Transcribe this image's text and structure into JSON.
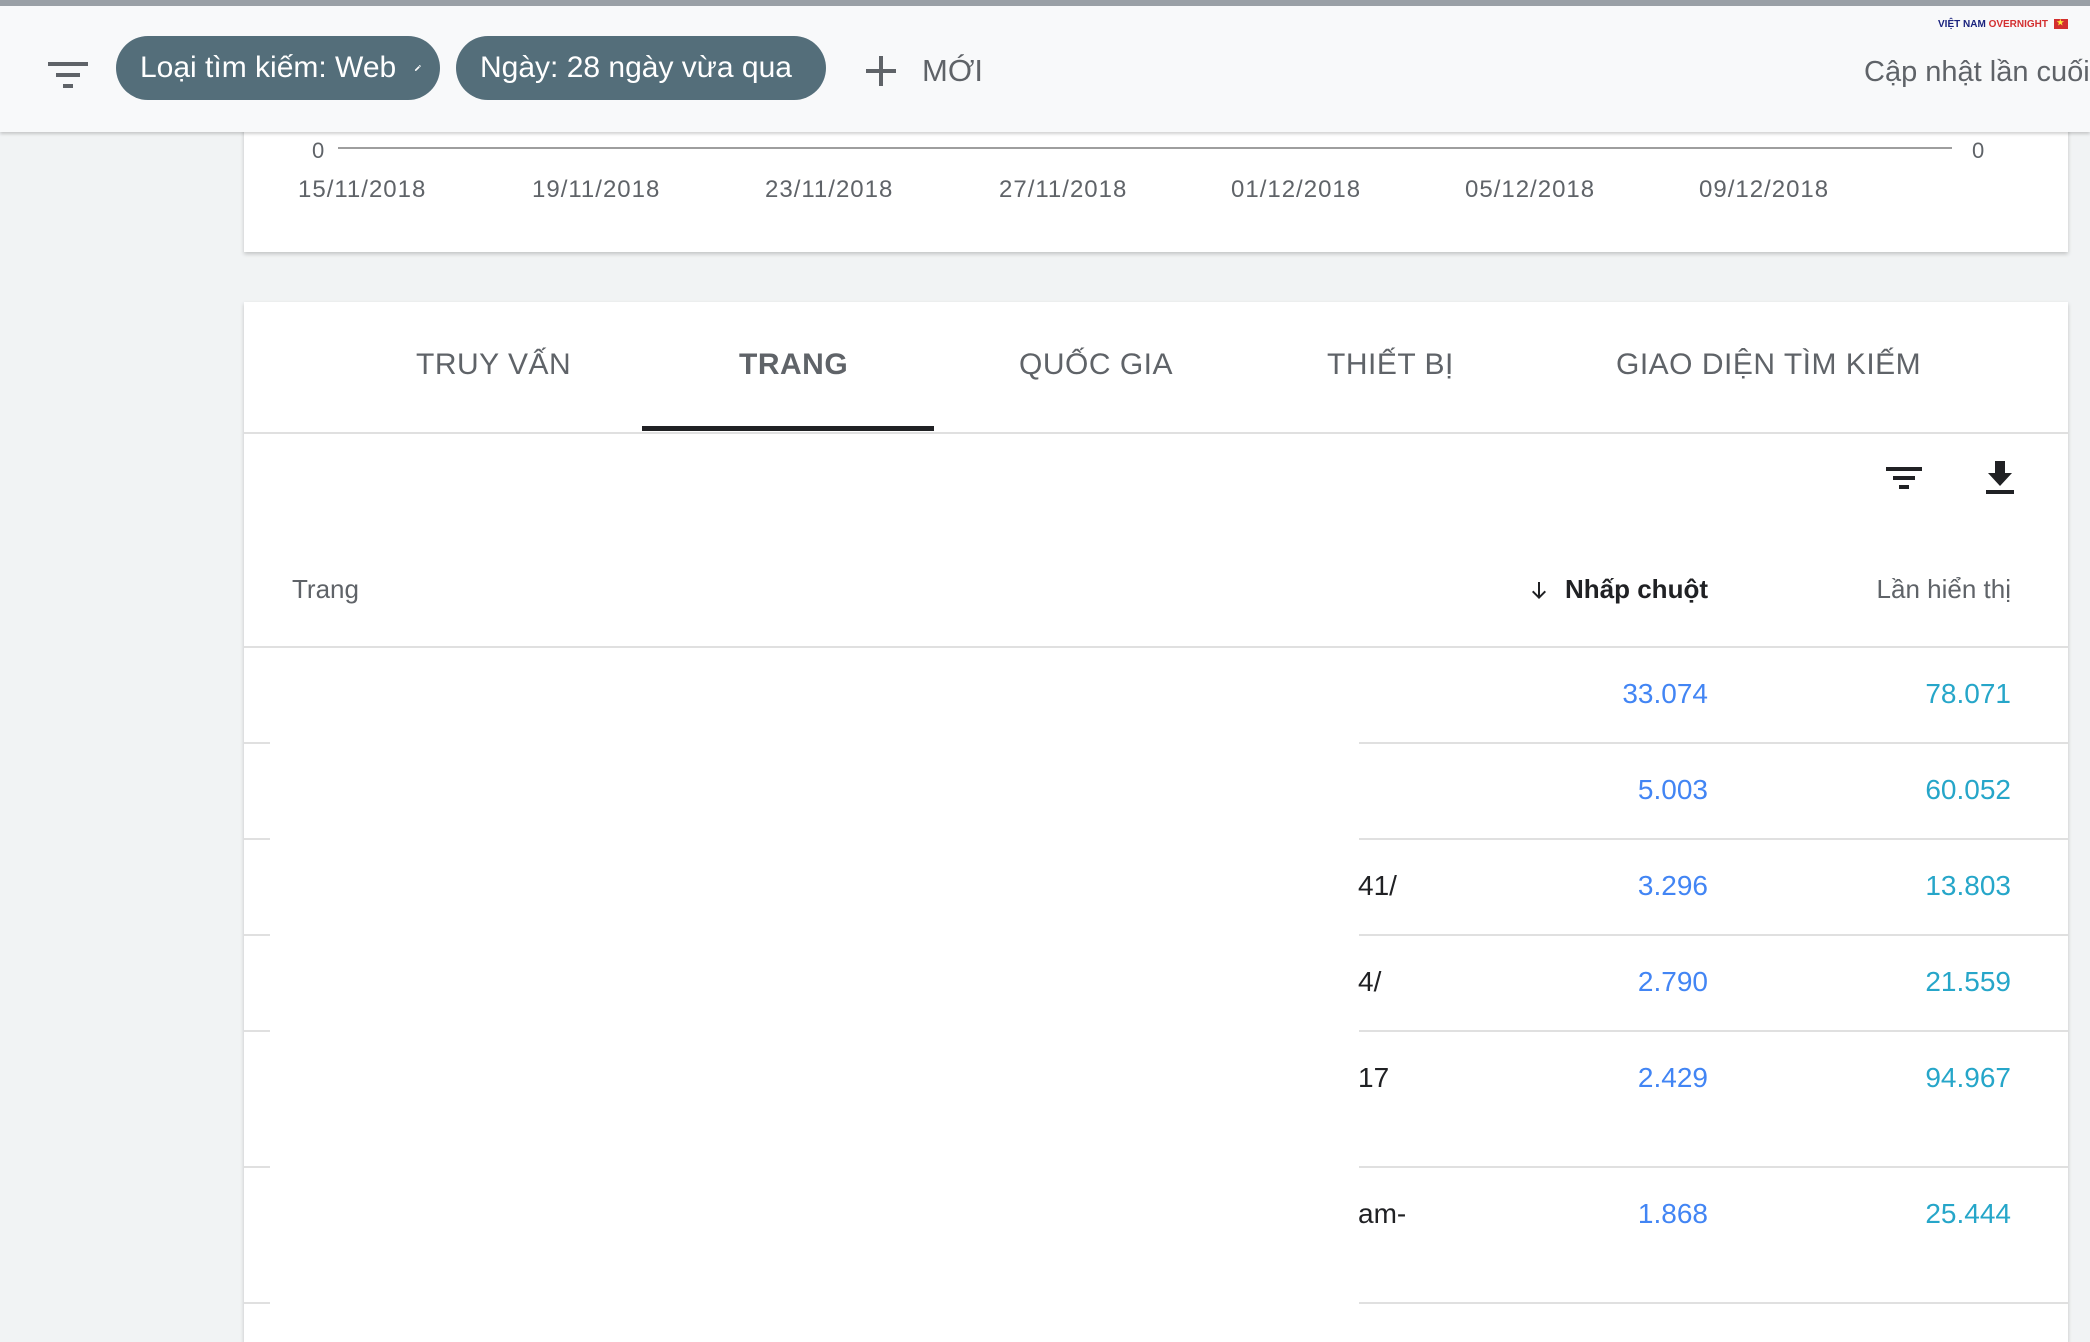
{
  "topbar": {
    "chips": [
      {
        "label": "Loại tìm kiếm: Web"
      },
      {
        "label": "Ngày: 28 ngày vừa qua"
      }
    ],
    "new_label": "MỚI",
    "last_updated": "Cập nhật lần cuối",
    "brand": {
      "part1": "VIỆT NAM",
      "part2": "OVERNIGHT"
    }
  },
  "chart": {
    "left_axis_zero": "0",
    "right_axis_zero": "0",
    "x_ticks": [
      "15/11/2018",
      "19/11/2018",
      "23/11/2018",
      "27/11/2018",
      "01/12/2018",
      "05/12/2018",
      "09/12/2018"
    ]
  },
  "tabs": [
    {
      "label": "TRUY VẤN"
    },
    {
      "label": "TRANG"
    },
    {
      "label": "QUỐC GIA"
    },
    {
      "label": "THIẾT BỊ"
    },
    {
      "label": "GIAO DIỆN TÌM KIẾM"
    }
  ],
  "active_tab": "TRANG",
  "table": {
    "headers": {
      "page": "Trang",
      "clicks": "Nhấp chuột",
      "impressions": "Lần hiển thị"
    },
    "sorted_by": "Nhấp chuột",
    "rows": [
      {
        "page_fragment": "",
        "clicks": "33.074",
        "impressions": "78.071"
      },
      {
        "page_fragment": "",
        "clicks": "5.003",
        "impressions": "60.052"
      },
      {
        "page_fragment": "41/",
        "clicks": "3.296",
        "impressions": "13.803"
      },
      {
        "page_fragment": "4/",
        "clicks": "2.790",
        "impressions": "21.559"
      },
      {
        "page_fragment": "17",
        "clicks": "2.429",
        "impressions": "94.967"
      },
      {
        "page_fragment": "am-",
        "clicks": "1.868",
        "impressions": "25.444"
      }
    ]
  },
  "icons": {
    "menu_filter": "filter-list-icon",
    "edit": "pencil-icon",
    "add": "plus-icon",
    "table_filter": "filter-list-icon",
    "download": "download-icon",
    "sort": "arrow-down-icon"
  },
  "colors": {
    "chip_bg": "#546e7a",
    "clicks": "#4285f4",
    "impressions": "#26a6c9",
    "active_tab_underline": "#202124"
  }
}
